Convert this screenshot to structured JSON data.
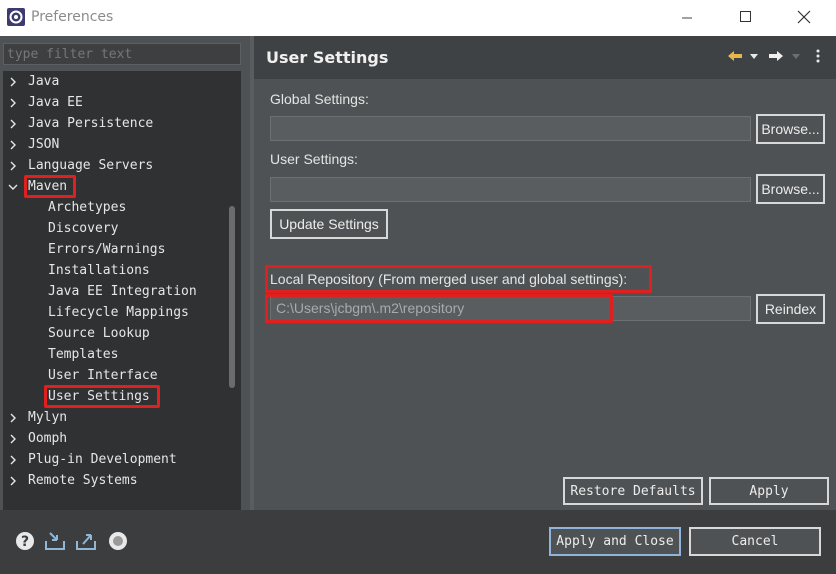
{
  "window": {
    "title": "Preferences",
    "minimize_icon": "minimize-icon",
    "maximize_icon": "maximize-icon",
    "close_icon": "close-icon"
  },
  "sidebar": {
    "filter_placeholder": "type filter text",
    "items": [
      {
        "label": "Java",
        "expanded": false,
        "level": 0
      },
      {
        "label": "Java EE",
        "expanded": false,
        "level": 0
      },
      {
        "label": "Java Persistence",
        "expanded": false,
        "level": 0
      },
      {
        "label": "JSON",
        "expanded": false,
        "level": 0
      },
      {
        "label": "Language Servers",
        "expanded": false,
        "level": 0
      },
      {
        "label": "Maven",
        "expanded": true,
        "level": 0
      },
      {
        "label": "Archetypes",
        "level": 1
      },
      {
        "label": "Discovery",
        "level": 1
      },
      {
        "label": "Errors/Warnings",
        "level": 1
      },
      {
        "label": "Installations",
        "level": 1
      },
      {
        "label": "Java EE Integration",
        "level": 1
      },
      {
        "label": "Lifecycle Mappings",
        "level": 1
      },
      {
        "label": "Source Lookup",
        "level": 1
      },
      {
        "label": "Templates",
        "level": 1
      },
      {
        "label": "User Interface",
        "level": 1
      },
      {
        "label": "User Settings",
        "level": 1,
        "selected": true
      },
      {
        "label": "Mylyn",
        "expanded": false,
        "level": 0
      },
      {
        "label": "Oomph",
        "expanded": false,
        "level": 0
      },
      {
        "label": "Plug-in Development",
        "expanded": false,
        "level": 0
      },
      {
        "label": "Remote Systems",
        "expanded": false,
        "level": 0
      }
    ]
  },
  "main": {
    "title": "User Settings",
    "global_settings_label": "Global Settings:",
    "global_settings_value": "",
    "browse_label_1": "Browse...",
    "user_settings_label": "User Settings:",
    "user_settings_value": "",
    "browse_label_2": "Browse...",
    "update_settings_label": "Update Settings",
    "local_repo_label": "Local Repository (From merged user and global settings):",
    "local_repo_value": "C:\\Users\\jcbgm\\.m2\\repository",
    "reindex_label": "Reindex",
    "restore_defaults_label": "Restore Defaults",
    "apply_label": "Apply"
  },
  "footer": {
    "apply_close_label": "Apply and Close",
    "cancel_label": "Cancel",
    "icons": [
      "help-icon",
      "import-icon",
      "export-icon",
      "record-icon"
    ]
  },
  "colors": {
    "highlight": "#e0201f",
    "background": "#4f5254",
    "tree_background": "#2f3133"
  }
}
